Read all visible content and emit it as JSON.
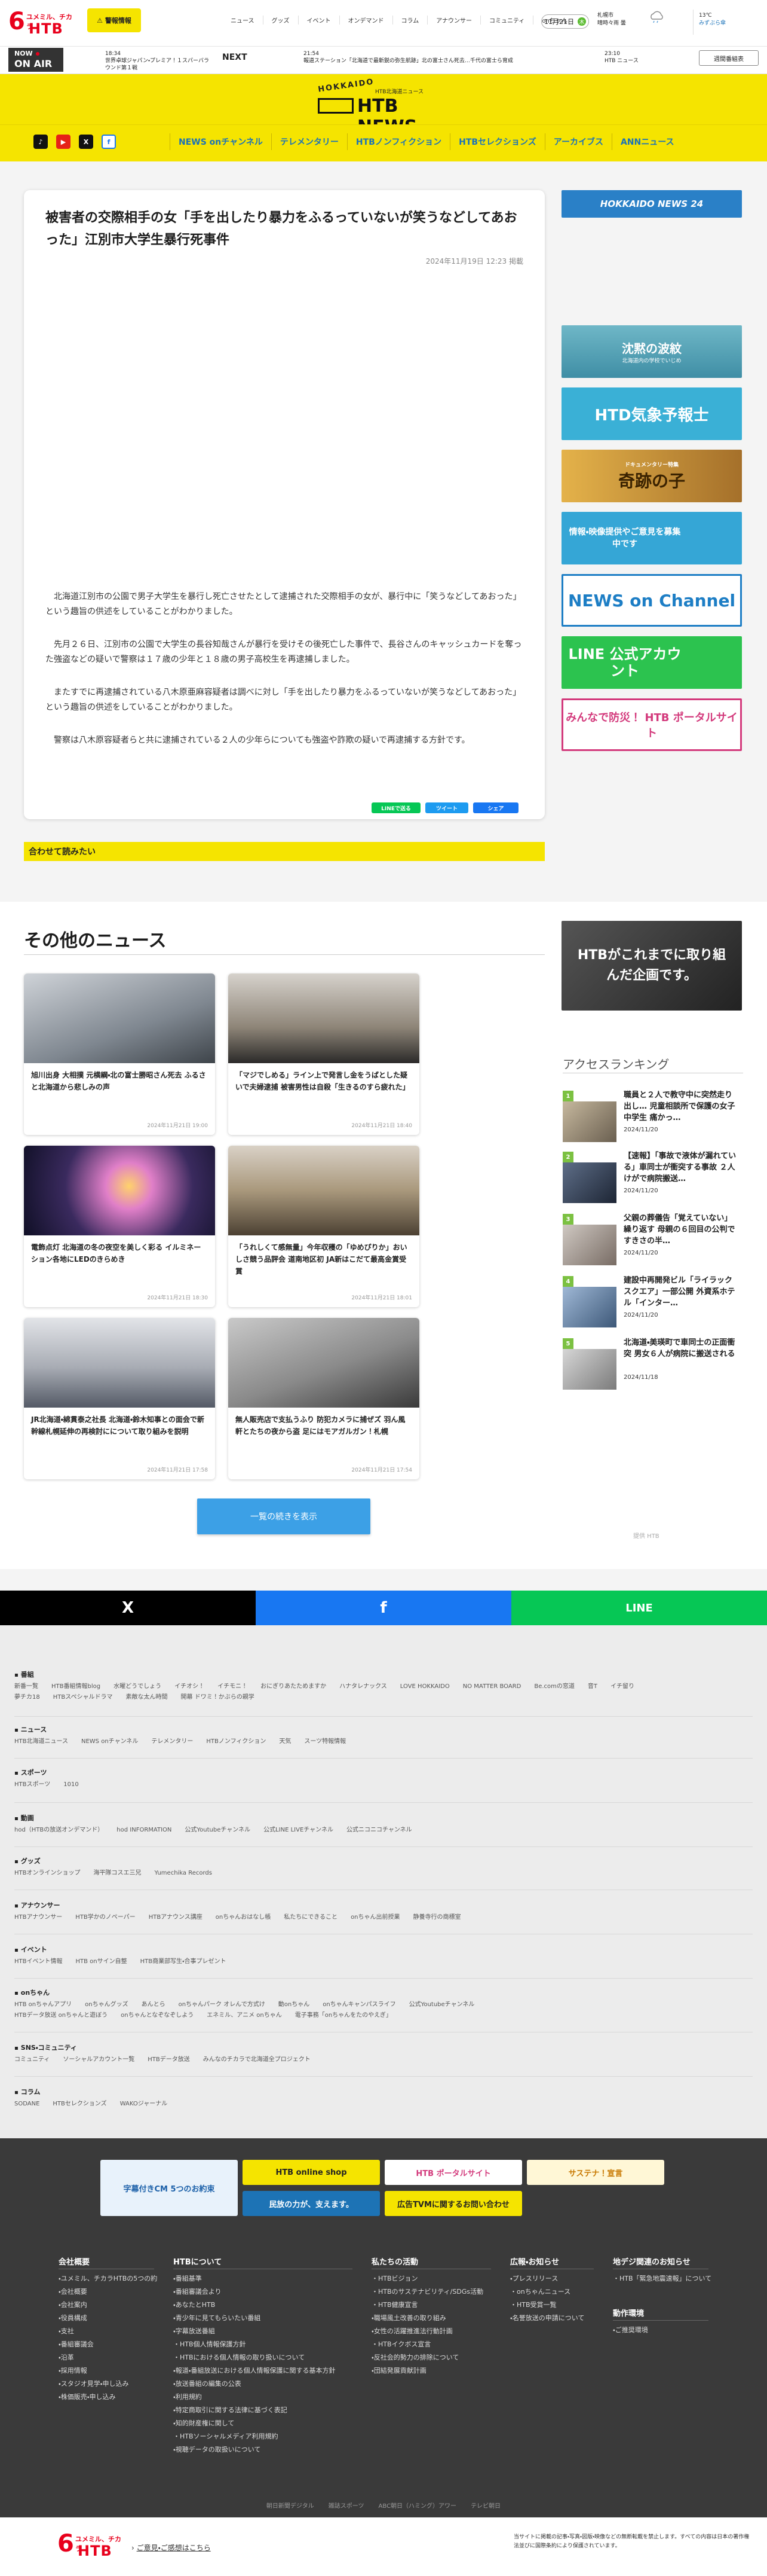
{
  "header": {
    "logo_kana": "ユメミル、チカラ",
    "logo_number": "6",
    "logo_text": "HTB",
    "weather_button": "警報情報",
    "nav": [
      "ニュース",
      "グッズ",
      "イベント",
      "オンデマンド",
      "コラム",
      "アナウンサー",
      "コミュニティ",
      "onちゃん"
    ],
    "date": "11月21日",
    "date_badge": "木",
    "weather_place": "札幌市",
    "weather_sub": "晴時々雨 曇",
    "weather_temp": "13℃",
    "weather_link": "みずぶら傘"
  },
  "onair": {
    "now": "NOW",
    "label": "ON AIR",
    "current_time": "18:34",
    "current_title": "世界卓球ジャパン・プレミア！１スパーバラウンド第１戦",
    "next_label": "NEXT",
    "next1_time": "21:54",
    "next1_title": "報道ステーション「北海道で最新鋭の弥生航跡」北の富士さん死去…千代の富士ら育成",
    "next2_time": "23:10",
    "next2_title": "HTB ニュース",
    "guide_button": "週間番組表"
  },
  "brand": {
    "top": "HOKKAIDO",
    "sub": "HTB北海道ニュース",
    "main": "HTB NEWS"
  },
  "nav": {
    "social": [
      "TikTok",
      "YouTube",
      "X",
      "Facebook"
    ],
    "items": [
      "NEWS onチャンネル",
      "テレメンタリー",
      "HTBノンフィクション",
      "HTBセレクションズ",
      "アーカイブス",
      "ANNニュース"
    ]
  },
  "article": {
    "title": "被害者の交際相手の女「手を出したり暴力をふるっていないが笑うなどしてあおった」江別市大学生暴行死事件",
    "date": "2024年11月19日 12:23 掲載",
    "paragraphs": [
      "北海道江別市の公園で男子大学生を暴行し死亡させたとして逮捕された交際相手の女が、暴行中に「笑うなどしてあおった」という趣旨の供述をしていることがわかりました。",
      "先月２６日、江別市の公園で大学生の長谷知哉さんが暴行を受けその後死亡した事件で、長谷さんのキャッシュカードを奪った強盗などの疑いで警察は１７歳の少年と１８歳の男子高校生を再逮捕しました。",
      "またすでに再逮捕されている八木原亜麻容疑者は調べに対し「手を出したり暴力をふるっていないが笑うなどしてあおった」という趣旨の供述をしていることがわかりました。",
      "警察は八木原容疑者らと共に逮捕されている２人の少年らについても強盗や詐欺の疑いで再逮捕する方針です。"
    ],
    "share": [
      "LINEで送る",
      "ツイート",
      "シェア"
    ],
    "related_heading": "合わせて読みたい"
  },
  "sidebar": {
    "banners": [
      {
        "text": "HOKKAIDO NEWS 24",
        "color": "#2a80c7"
      },
      {
        "text": "沈黙の波紋",
        "sub": "北海道内の学校でいじめ",
        "color": "#4a9cb0"
      },
      {
        "text": "HTD気象予報士",
        "color": "#3ab0d6"
      },
      {
        "text": "奇跡の子",
        "sub": "ドキュメンタリー特集",
        "color": "#c99628"
      },
      {
        "text": "情報・映像提供やご意見を募集中です",
        "color": "#35a6d6"
      },
      {
        "text": "NEWS on Channel",
        "color": "#1d7ec5"
      },
      {
        "text": "LINE 公式アカウント",
        "color": "#2cc34f"
      },
      {
        "text": "みんなで防災！ HTB ポータルサイト",
        "color": "#d33a7c"
      }
    ],
    "promo": "HTBがこれまでに取り組んだ企画です。"
  },
  "others": {
    "title": "その他のニュース",
    "cards": [
      {
        "title": "旭川出身 大相撲 元横綱・北の富士勝昭さん死去 ふるさと北海道から悲しみの声",
        "date": "2024年11月21日 19:00"
      },
      {
        "title": "「マジでしめる」ライン上で発言し金をうばとした疑いで夫婦逮捕 被害男性は自殺「生きるのすら疲れた」",
        "date": "2024年11月21日 18:40"
      },
      {
        "title": "電飾点灯 北海道の冬の夜空を美しく彩る イルミネーション各地にLEDのきらめき",
        "date": "2024年11月21日 18:30"
      },
      {
        "title": "「うれしくて感無量」今年収穫の「ゆめぴりか」おいしさ競う品評会 道南地区初 JA新はこだて最高金賞受賞",
        "date": "2024年11月21日 18:01"
      },
      {
        "title": "JR北海道・綿貫泰之社長 北海道・鈴木知事との面会で新幹線札幌延伸の再検討にについて取り組みを説明",
        "date": "2024年11月21日 17:58"
      },
      {
        "title": "無人販売店で支払うふり 防犯カメラに捕ぜズ 羽ん風軒とたちの夜から盗 足にはモアガルガン！札幌",
        "date": "2024年11月21日 17:54"
      }
    ],
    "more_button": "一覧の続きを表示"
  },
  "ranking": {
    "title": "アクセスランキング",
    "items": [
      {
        "num": "1",
        "title": "職員と２人で教守中に突然走り出し… 児童相談所で保護の女子中学生 痛かっ…",
        "date": "2024/11/20"
      },
      {
        "num": "2",
        "title": "【速報】「事故で液体が漏れている」車同士が衝突する事故 ２人けがで病院搬送…",
        "date": "2024/11/20"
      },
      {
        "num": "3",
        "title": "父親の葬儀告「覚えていない」繰り返す 母親の６回目の公判で すきさの半…",
        "date": "2024/11/20"
      },
      {
        "num": "4",
        "title": "建設中再開発ビル「ライラックスクエア」一部公開 外資系ホテル「インター…",
        "date": "2024/11/20"
      },
      {
        "num": "5",
        "title": "北海道・美瑛町で車同士の正面衝突 男女６人が病院に搬送される",
        "date": "2024/11/18"
      }
    ],
    "foot": "提供 HTB"
  },
  "sharebar": [
    "X",
    "f",
    "LINE"
  ],
  "sitemap": [
    {
      "head": "番組",
      "links": [
        "新番一覧",
        "HTB番組情報blog",
        "水曜どうでしょう",
        "イチオシ！",
        "イチモニ！",
        "おにぎりあたためますか",
        "ハナタレナックス",
        "LOVE HOKKAIDO",
        "NO MATTER BOARD",
        "Be.comの窓道",
        "音T",
        "イチ留り",
        "夢チカ18",
        "HTBスペシャルドラマ",
        "素敵な太ん時間",
        "開幕 ドワミ！かぶらの親学"
      ]
    },
    {
      "head": "ニュース",
      "links": [
        "HTB北海道ニュース",
        "NEWS onチャンネル",
        "テレメンタリー",
        "HTBノンフィクション",
        "天気",
        "スーツ特報情報"
      ]
    },
    {
      "head": "スポーツ",
      "links": [
        "HTBスポーツ",
        "1010"
      ]
    },
    {
      "head": "動画",
      "links": [
        "hod（HTBの放送オンデマンド）",
        "hod INFORMATION",
        "公式Youtubeチャンネル",
        "公式LINE LIVEチャンネル",
        "公式ニコニコチャンネル"
      ]
    },
    {
      "head": "グッズ",
      "links": [
        "HTBオンラインショップ",
        "海平隊コスエ三兄",
        "Yumechika Records"
      ]
    },
    {
      "head": "アナウンサー",
      "links": [
        "HTBアナウンサー",
        "HTB学かのノペーパー",
        "HTBアナウンス講座",
        "onちゃんおはなし帳",
        "私たちにできること",
        "onちゃん出前授業",
        "静養寺行の商標室"
      ]
    },
    {
      "head": "イベント",
      "links": [
        "HTBイベント情報",
        "HTB onサイン自整",
        "HTB商業部写生・合事プレゼント"
      ]
    },
    {
      "head": "onちゃん",
      "links": [
        "HTB onちゃんアプリ",
        "onちゃんグッズ",
        "あんとら",
        "onちゃんパーク オレんで方式け",
        "動onちゃん",
        "onちゃんキャンパスライフ",
        "公式Youtubeチャンネル",
        "HTBデータ放送 onちゃんと遊ぼう",
        "onちゃんとなぞなぞしよう",
        "エネミル、アニメ onちゃん",
        "電子事務「onちゃんをたのやえぎ」"
      ]
    },
    {
      "head": "SNS・コミュニティ",
      "links": [
        "コミュニティ",
        "ソーシャルアカウント一覧",
        "HTBデータ放送",
        "みんなのチカラで北海道全プロジェクト"
      ]
    },
    {
      "head": "コラム",
      "links": [
        "SODANE",
        "HTBセレクションズ",
        "WAKOジャーナル"
      ]
    }
  ],
  "footer": {
    "banners": [
      {
        "text": "字幕付きCM 5つのお約束",
        "color": "#e8f2fb",
        "fg": "#1a5fa8"
      },
      {
        "text": "HTB online shop",
        "color": "#f5e400",
        "fg": "#222"
      },
      {
        "text": "HTB ポータルサイト",
        "color": "#ffffff",
        "fg": "#d33a7c"
      },
      {
        "text": "サステナ！宣言",
        "color": "#fff7d6",
        "fg": "#c87800"
      },
      {
        "text": "民放の力が、支えます。",
        "color": "#1d73b5",
        "fg": "#fff"
      },
      {
        "text": "広告TVMに関するお問い合わせ",
        "color": "#f5e400",
        "fg": "#222"
      }
    ],
    "columns": [
      {
        "head": "会社概要",
        "items": [
          "ユメミル、チカラHTBの5つの約",
          "会社概要",
          "会社案内",
          "役員構成",
          "支社",
          "番組審議会",
          "沿革",
          "採用情報",
          "スタジオ見学・申し込み",
          "株価販売・申し込み"
        ]
      },
      {
        "head": "HTBについて",
        "items": [
          "番組基準",
          "番組審議会より",
          "あなたとHTB",
          "青少年に見てもらいたい番組",
          "字幕放送番組",
          "HTB個人情報保護方針",
          "HTBにおける個人情報の取り扱いについて",
          "報道・番組放送における個人情報保護に関する基本方針",
          "放送番組の編集の公表",
          "利用規約",
          "特定商取引に関する法律に基づく表記",
          "知的財産権に関して",
          "HTBソーシャルメディア利用規約",
          "視聴データの取扱いについて"
        ]
      },
      {
        "head": "私たちの活動",
        "items": [
          "HTBビジョン",
          "HTBのサステナビリティ/SDGs活動",
          "HTB健康宣言",
          "職場風土改善の取り組み",
          "女性の活躍推進法行動計画",
          "HTBイクボス宣言",
          "反社会的勢力の排除について",
          "団結発展貢献計画"
        ]
      },
      {
        "head": "広報・お知らせ",
        "items": [
          "プレスリリース",
          "onちゃんニュース",
          "HTB受賞一覧",
          "名誉放送の申請について"
        ]
      },
      {
        "head": "地デジ関連のお知らせ",
        "items": [
          "HTB「緊急地震速報」について"
        ]
      },
      {
        "head": "動作環境",
        "items": [
          "ご推奨環境"
        ]
      }
    ],
    "links": [
      "朝日新聞デジタル",
      "雑誌スポーツ",
      "ABC朝日（ハミング）アワー",
      "テレビ朝日"
    ],
    "contact": "ご意見・ご感想はこちら",
    "copyright": "当サイトに掲載の記事・写真・図版・映像などの無断転載を禁止します。すべての内容は日本の著作権法並びに国際条約により保護されています。"
  }
}
